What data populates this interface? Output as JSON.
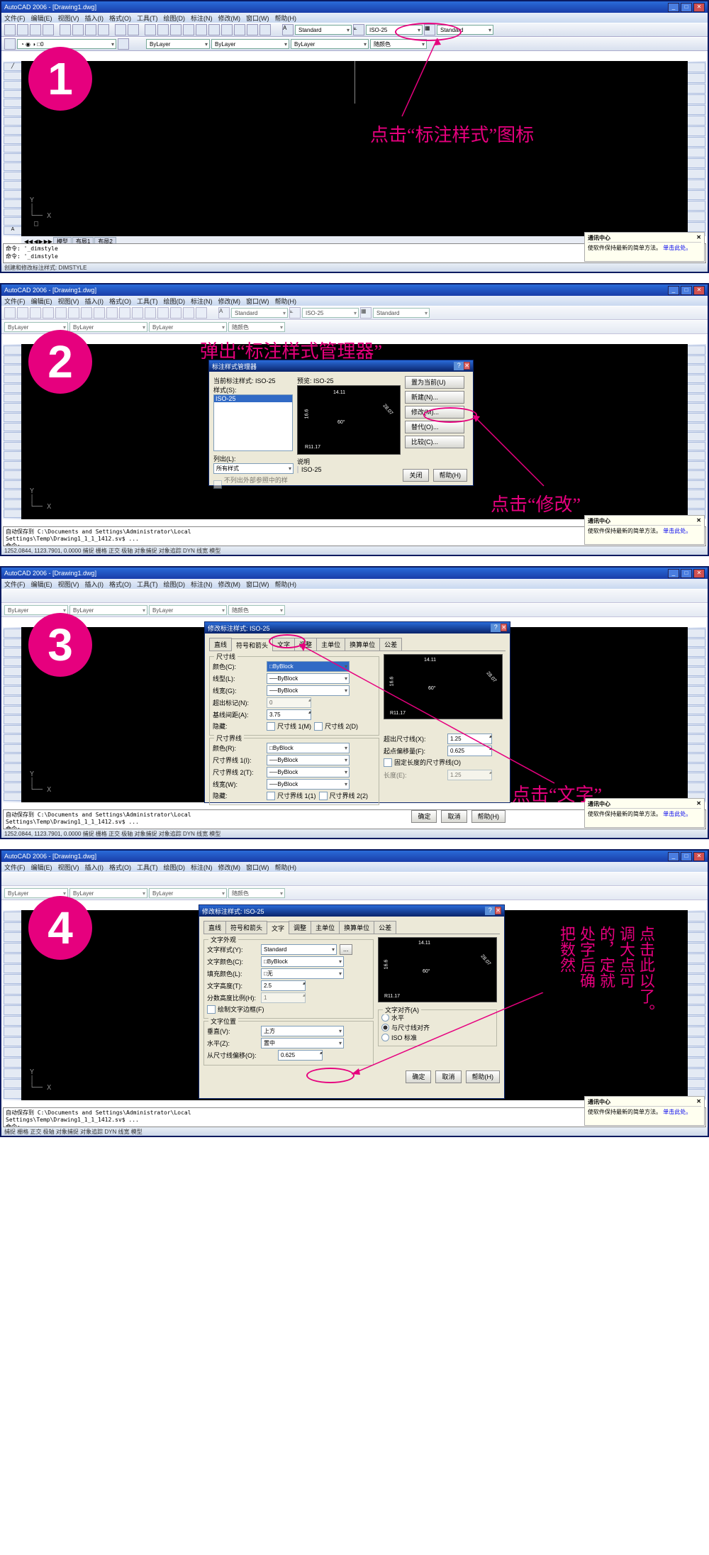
{
  "app": {
    "title": "AutoCAD 2006 - [Drawing1.dwg]"
  },
  "menus": [
    "文件(F)",
    "编辑(E)",
    "视图(V)",
    "插入(I)",
    "格式(O)",
    "工具(T)",
    "绘图(D)",
    "标注(N)",
    "修改(M)",
    "窗口(W)",
    "帮助(H)"
  ],
  "toolbar": {
    "textStyle": "Standard",
    "dimStyle": "ISO-25",
    "tableStyle": "Standard",
    "layer": "ByLayer",
    "color": "ByLayer",
    "ltype": "ByLayer",
    "plotStyle": "随颜色"
  },
  "tabs": {
    "modelTab": "模型",
    "layout1": "布局1",
    "layout2": "布局2"
  },
  "commCenter": {
    "title": "通讯中心",
    "body": "使软件保持最新的简单方法。",
    "link": "单击此处。"
  },
  "step1": {
    "num": "1",
    "anno": "点击“标注样式”图标",
    "cmd": "命令: '_dimstyle\n命令: '_dimstyle",
    "status": "创建和修改标注样式:   DIMSTYLE"
  },
  "step2": {
    "num": "2",
    "anno1": "弹出“标注样式管理器”",
    "anno2": "点击“修改”",
    "dialog": {
      "title": "标注样式管理器",
      "currentLabel": "当前标注样式: ISO-25",
      "stylesLabel": "样式(S):",
      "current": "ISO-25",
      "previewLabel": "预览: ISO-25",
      "listLabel": "列出(L):",
      "listValue": "所有样式",
      "xrefChk": "不列出外部参照中的样式",
      "descLabel": "说明",
      "desc": "ISO-25",
      "btns": {
        "setCurrent": "置为当前(U)",
        "new": "新建(N)...",
        "modify": "修改(M)...",
        "override": "替代(O)...",
        "compare": "比较(C)..."
      },
      "close": "关闭",
      "help": "帮助(H)"
    },
    "cmd": "自动保存到 C:\\Documents and Settings\\Administrator\\Local\nSettings\\Temp\\Drawing1_1_1_1412.sv$ ...\n命令:",
    "status": "1252.0844, 1123.7901, 0.0000          捕捉 栅格 正交 极轴 对象捕捉 对象追踪 DYN 线宽 模型"
  },
  "step3": {
    "num": "3",
    "anno": "点击“文字”",
    "dialogTitle": "修改标注样式: ISO-25",
    "tabs": [
      "直线",
      "符号和箭头",
      "文字",
      "调整",
      "主单位",
      "换算单位",
      "公差"
    ],
    "activeTab": "符号和箭头",
    "group_dimLine": "尺寸线",
    "dimLine": {
      "colorL": "颜色(C):",
      "color": "ByBlock",
      "ltypeL": "线型(L):",
      "ltype": "ByBlock",
      "lweightL": "线宽(G):",
      "lweight": "ByBlock",
      "extBeyondL": "超出标记(N):",
      "extBeyond": "0",
      "baselineSpL": "基线间距(A):",
      "baselineSp": "3.75",
      "suppressL": "隐藏:",
      "sup1": "尺寸线 1(M)",
      "sup2": "尺寸线 2(D)"
    },
    "group_extLine": "尺寸界线",
    "extLine": {
      "colorL": "颜色(R):",
      "color": "ByBlock",
      "lt1L": "尺寸界线 1(I):",
      "lt1": "ByBlock",
      "lt2L": "尺寸界线 2(T):",
      "lt2": "ByBlock",
      "lwL": "线宽(W):",
      "lw": "ByBlock",
      "suppressL": "隐藏:",
      "sup1": "尺寸界线 1(1)",
      "sup2": "尺寸界线 2(2)",
      "extBeyondDimL": "超出尺寸线(X):",
      "extBeyondDim": "1.25",
      "originOffL": "起点偏移量(F):",
      "originOff": "0.625",
      "fixedLenChk": "固定长度的尺寸界线(O)",
      "fixedLenL": "长度(E):",
      "fixedLen": "1.25"
    },
    "ok": "确定",
    "cancel": "取消",
    "help": "帮助(H)",
    "cmd": "自动保存到 C:\\Documents and Settings\\Administrator\\Local\nSettings\\Temp\\Drawing1_1_1_1412.sv$ ...\n命令:",
    "status": "1252.0844, 1123.7901, 0.0000          捕捉 栅格 正交 极轴 对象捕捉 对象追踪 DYN 线宽 模型"
  },
  "step4": {
    "num": "4",
    "dialogTitle": "修改标注样式: ISO-25",
    "activeTab": "文字",
    "group_appearance": "文字外观",
    "appearance": {
      "styleL": "文字样式(Y):",
      "style": "Standard",
      "colorL": "文字颜色(C):",
      "color": "ByBlock",
      "fillL": "填充颜色(L):",
      "fill": "无",
      "heightL": "文字高度(T):",
      "height": "2.5",
      "fracScaleL": "分数高度比例(H):",
      "fracScale": "1",
      "frameChk": "绘制文字边框(F)"
    },
    "group_placement": "文字位置",
    "placement": {
      "vertL": "垂直(V):",
      "vert": "上方",
      "horizL": "水平(Z):",
      "horiz": "置中",
      "offsetL": "从尺寸线偏移(O):",
      "offset": "0.625"
    },
    "group_align": "文字对齐(A)",
    "align": {
      "horiz": "水平",
      "withDim": "与尺寸线对齐",
      "iso": "ISO 标准"
    },
    "ok": "确定",
    "cancel": "取消",
    "help": "帮助(H)",
    "vertAnno": [
      "点",
      "击",
      "此",
      "处",
      "的",
      "字",
      "，",
      "调",
      "大",
      "点",
      "后",
      "确",
      "定",
      "就",
      "可",
      "以",
      "了",
      "。",
      "把",
      "数",
      "然"
    ],
    "cmd": "自动保存到 C:\\Documents and Settings\\Administrator\\Local\nSettings\\Temp\\Drawing1_1_1_1412.sv$ ...\n命令:",
    "status": "捕捉 栅格 正交 极轴 对象捕捉 对象追踪 DYN 线宽 模型"
  },
  "previewDims": {
    "top": "14.11",
    "left": "16.6",
    "right": "28.07",
    "diag": "60°",
    "bl": "R11.17"
  }
}
